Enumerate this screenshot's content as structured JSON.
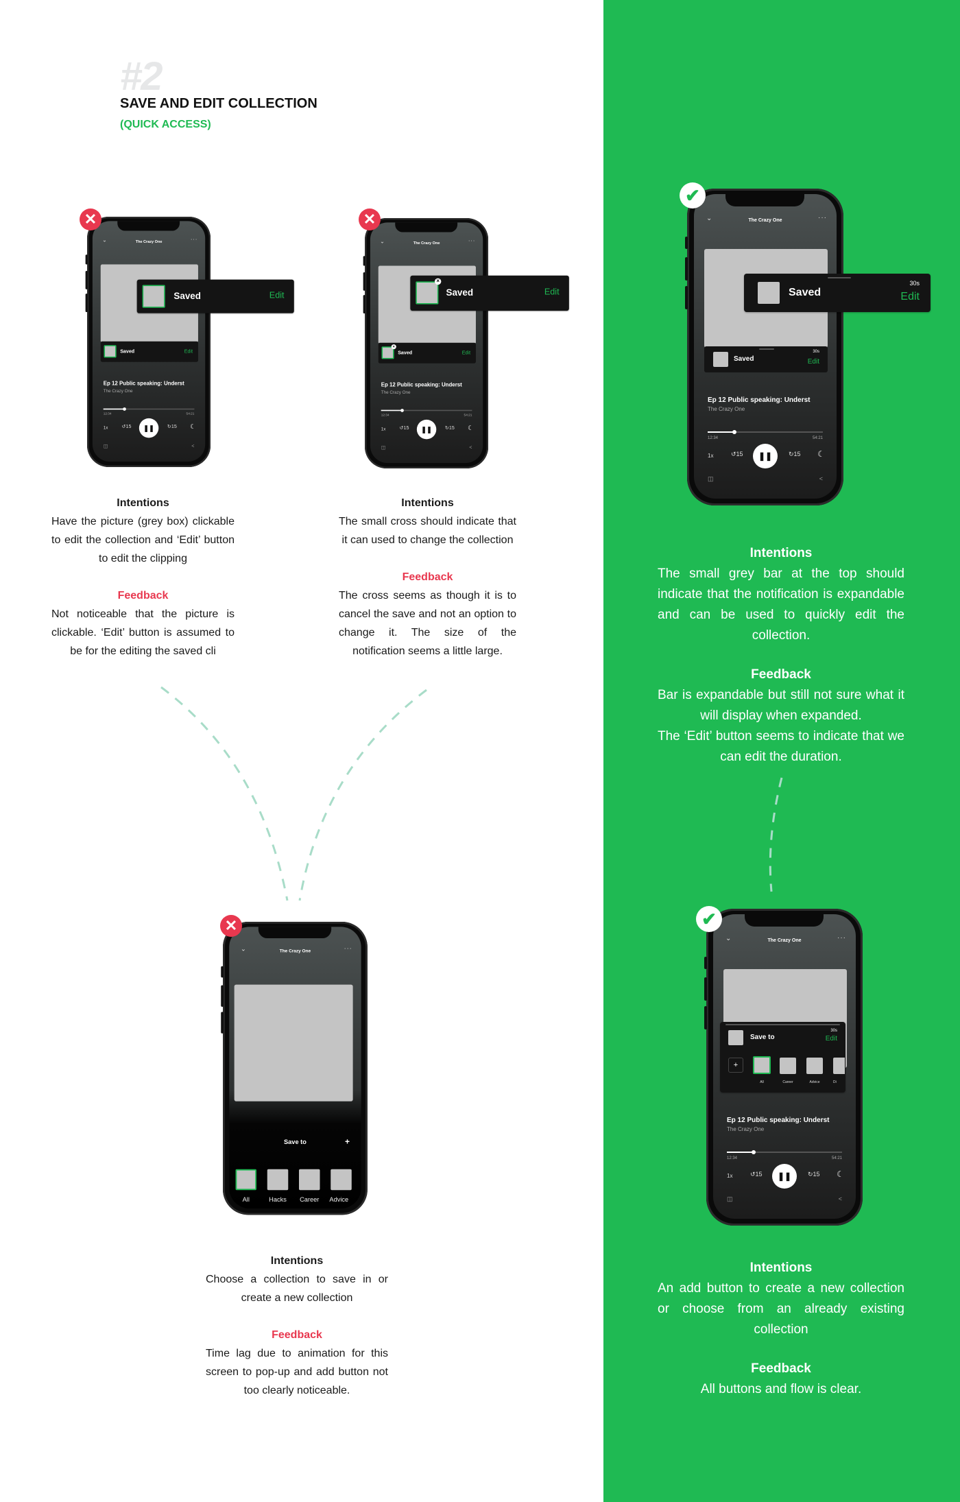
{
  "header": {
    "number": "#2",
    "title": "SAVE AND EDIT COLLECTION",
    "subtitle": "(QUICK ACCESS)"
  },
  "colors": {
    "accent_green": "#1fba53",
    "fail_red": "#e8384f",
    "panel_green": "#1fba53",
    "connector": "#a8dcc8"
  },
  "player": {
    "show": "The Crazy One",
    "episode": "Ep 12 Public speaking: Underst",
    "elapsed": "12:34",
    "total": "54:21",
    "speed": "1x",
    "skip": "15",
    "progress": 0.23,
    "icons": [
      "chevron-down-icon",
      "more-icon",
      "replay-15-icon",
      "pause-icon",
      "forward-15-icon",
      "sleep-timer-moon-icon",
      "devices-icon",
      "share-icon"
    ]
  },
  "screens": [
    {
      "verdict": "fail",
      "notification": {
        "label": "Saved",
        "edit": "Edit"
      },
      "intentions_heading": "Intentions",
      "intentions": "Have the picture (grey box) clickable to edit the collection and ‘Edit’ button to edit the clipping",
      "feedback_heading": "Feedback",
      "feedback": "Not noticeable that the picture is clickable. ‘Edit’ button is assumed to be for the editing the saved cli"
    },
    {
      "verdict": "fail",
      "notification": {
        "label": "Saved",
        "edit": "Edit"
      },
      "intentions_heading": "Intentions",
      "intentions": "The small cross should indicate that it can used to change the collection",
      "feedback_heading": "Feedback",
      "feedback": "The cross seems as though it is to cancel the save and not an option to change it. The size of the notification seems a little large."
    },
    {
      "verdict": "pass",
      "notification": {
        "label": "Saved",
        "duration": "30s",
        "edit": "Edit"
      },
      "intentions_heading": "Intentions",
      "intentions": "The small grey bar at the top should indicate that the notification is expandable and can be used to quickly edit the collection.",
      "feedback_heading": "Feedback",
      "feedback": "Bar is expandable but still not sure what it will display when expanded.",
      "feedback_2": "The ‘Edit’ button seems to indicate that we can edit the duration."
    },
    {
      "verdict": "fail",
      "sheet": {
        "title": "Save to",
        "add": "+",
        "collections": [
          "All",
          "Hacks",
          "Career",
          "Advice"
        ]
      },
      "intentions_heading": "Intentions",
      "intentions": "Choose a collection to save in or create a new collection",
      "feedback_heading": "Feedback",
      "feedback": "Time lag due to animation for this screen to pop-up and add button not too clearly noticeable."
    },
    {
      "verdict": "pass",
      "sheet": {
        "title": "Save to",
        "duration": "30s",
        "edit": "Edit",
        "add": "+",
        "collections": [
          "All",
          "Career",
          "Advice",
          "Di"
        ]
      },
      "intentions_heading": "Intentions",
      "intentions": "An add button to create a new collection or choose from an already existing collection",
      "feedback_heading": "Feedback",
      "feedback": "All buttons and flow is clear."
    }
  ]
}
